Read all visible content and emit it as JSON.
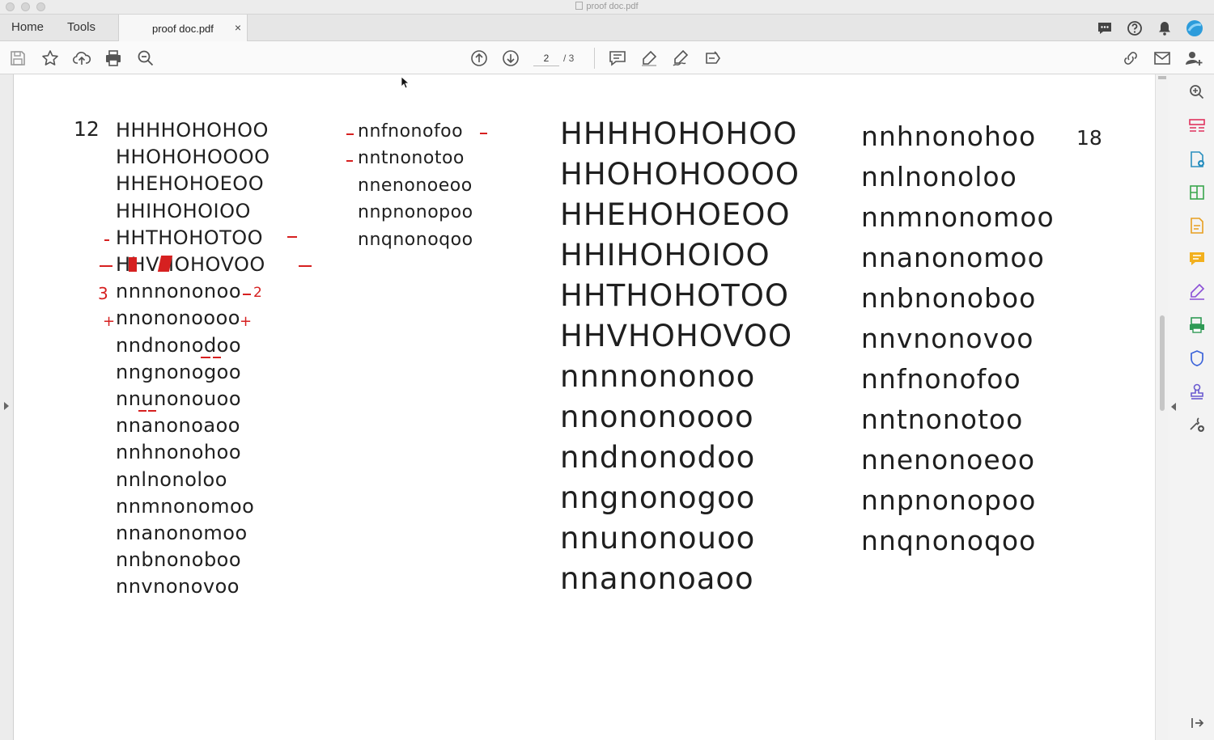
{
  "window": {
    "title": "proof doc.pdf"
  },
  "tabs": {
    "home": "Home",
    "tools": "Tools",
    "document": "proof doc.pdf",
    "close": "×"
  },
  "toolbar": {
    "page_current": "2",
    "page_total": "/ 3"
  },
  "left_column": {
    "size_label": "12",
    "lines": [
      "HHHHOHOHOO",
      "HHOHOHOOOO",
      "HHEHOHOEOO",
      "HHIHOHOIOO",
      "HHTHOHOTOO",
      "HHVHOHOVOO",
      "nnnnononoo",
      "nnononoooo",
      "nndnonodoo",
      "nngnonogoo",
      "nnunonouoo",
      "nnanonoaoo",
      "nnhnonohoo",
      "nnlnonoloo",
      "nnmnonomoo",
      "nnanonomoo",
      "nnbnonoboo",
      "nnvnonovoo"
    ]
  },
  "middle_column": {
    "lines": [
      "nnfnonofoo",
      "nntnonotoo",
      "nnenonoeoo",
      "nnpnonopoo",
      "nnqnonoqoo"
    ]
  },
  "large_left_column": {
    "lines": [
      "HHHHOHOHOO",
      "HHOHOHOOOO",
      "HHEHOHOEOO",
      "HHIHOHOIOO",
      "HHTHOHOTOO",
      "HHVHOHOVOO",
      "nnnnononoo",
      "nnononoooo",
      "nndnonodoo",
      "nngnonogoo",
      "nnunonouoo",
      "nnanonoaoo"
    ]
  },
  "large_right_column": {
    "size_label": "18",
    "lines": [
      "nnhnonohoo",
      "nnlnonoloo",
      "nnmnonomoo",
      "nnanonomoo",
      "nnbnonoboo",
      "nnvnonovoo",
      "nnfnonofoo",
      "nntnonotoo",
      "nnenonoeoo",
      "nnpnonopoo",
      "nnqnonoqoo"
    ]
  },
  "annotations": {
    "minus": "-",
    "plus": "+",
    "three": "3",
    "two": "2"
  },
  "colors": {
    "annotation": "#d62020",
    "accent": "#2d9cdb"
  },
  "icons": [
    "save-icon",
    "star-icon",
    "upload-icon",
    "print-icon",
    "zoom-out-icon",
    "page-up-icon",
    "page-down-icon",
    "comment-icon",
    "highlight-icon",
    "sign-icon",
    "redact-icon",
    "share-link-icon",
    "email-icon",
    "add-user-icon",
    "chat-icon",
    "help-icon",
    "bell-icon",
    "avatar-icon"
  ]
}
